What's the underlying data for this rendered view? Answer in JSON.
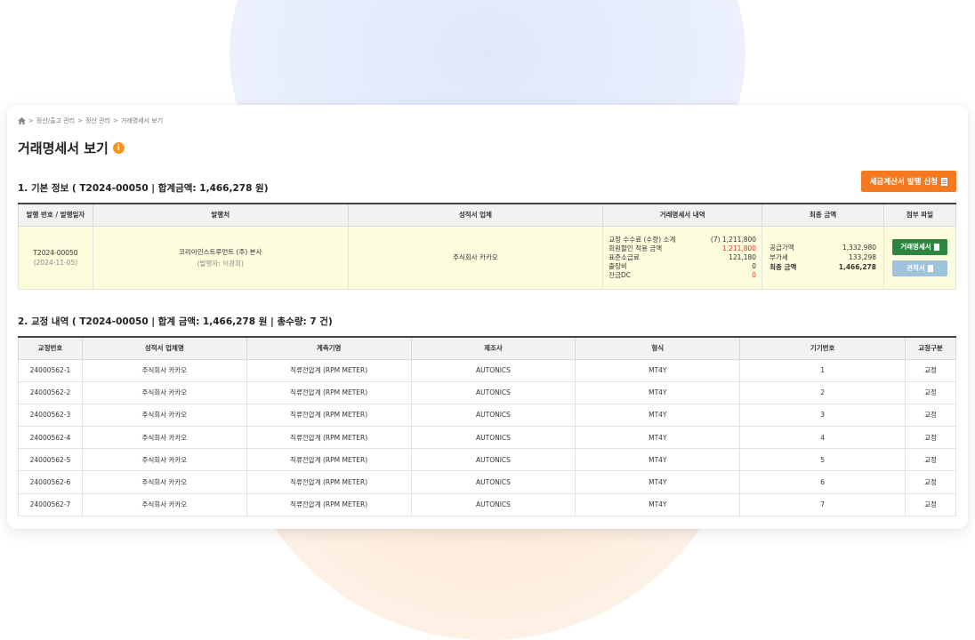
{
  "breadcrumb": [
    "정산/출고 관리",
    "정산 관리",
    "거래명세서 보기"
  ],
  "page_title": "거래명세서 보기",
  "info_icon_glyph": "i",
  "section1_title": "1. 기본 정보 ( T2024-00050 | 합계금액: 1,466,278 원)",
  "tax_button_label": "세금계산서 발행 신청",
  "basic_table": {
    "headers": [
      "발행 번호 / 발행일자",
      "발행처",
      "성적서 업체",
      "거래명세서 내역",
      "최종 금액",
      "첨부 파일"
    ],
    "issue_no": "T2024-00050",
    "issue_date": "(2024-11-05)",
    "issuer": "코리아인스트루먼트 (주) 본사",
    "issuer_sub": "(발행자: 이광희)",
    "cert_company": "주식회사 카카오",
    "details": [
      {
        "label": "교정 수수료 (수량) 소계",
        "value": "(7) 1,211,800",
        "red": false
      },
      {
        "label": "회원할인 적용 금액",
        "value": "1,211,800",
        "red": true
      },
      {
        "label": "표준소급료",
        "value": "121,180",
        "red": false
      },
      {
        "label": "출장비",
        "value": "0",
        "red": false
      },
      {
        "label": "잔금DC",
        "value": "0",
        "red": true
      }
    ],
    "final": [
      {
        "label": "공급가액",
        "value": "1,332,980",
        "bold": false
      },
      {
        "label": "부가세",
        "value": "133,298",
        "bold": false
      },
      {
        "label": "최종 금액",
        "value": "1,466,278",
        "bold": true
      }
    ],
    "file_buttons": [
      "거래명세서",
      "견적서"
    ]
  },
  "section2_title": "2. 교정 내역 ( T2024-00050 | 합계 금액: 1,466,278 원 | 총수량: 7 건)",
  "calib_table": {
    "headers": [
      "교정번호",
      "성적서 업체명",
      "계측기명",
      "제조사",
      "형식",
      "기기번호",
      "교정구분"
    ],
    "rows": [
      [
        "24000562-1",
        "주식회사 카카오",
        "직류전압계 (RPM METER)",
        "AUTONICS",
        "MT4Y",
        "1",
        "교정"
      ],
      [
        "24000562-2",
        "주식회사 카카오",
        "직류전압계 (RPM METER)",
        "AUTONICS",
        "MT4Y",
        "2",
        "교정"
      ],
      [
        "24000562-3",
        "주식회사 카카오",
        "직류전압계 (RPM METER)",
        "AUTONICS",
        "MT4Y",
        "3",
        "교정"
      ],
      [
        "24000562-4",
        "주식회사 카카오",
        "직류전압계 (RPM METER)",
        "AUTONICS",
        "MT4Y",
        "4",
        "교정"
      ],
      [
        "24000562-5",
        "주식회사 카카오",
        "직류전압계 (RPM METER)",
        "AUTONICS",
        "MT4Y",
        "5",
        "교정"
      ],
      [
        "24000562-6",
        "주식회사 카카오",
        "직류전압계 (RPM METER)",
        "AUTONICS",
        "MT4Y",
        "6",
        "교정"
      ],
      [
        "24000562-7",
        "주식회사 카카오",
        "직류전압계 (RPM METER)",
        "AUTONICS",
        "MT4Y",
        "7",
        "교정"
      ]
    ]
  },
  "colors": {
    "accent_orange": "#f47a20",
    "green_button": "#2e8540",
    "highlight_row": "#fdfdde",
    "red_text": "#e53935"
  }
}
